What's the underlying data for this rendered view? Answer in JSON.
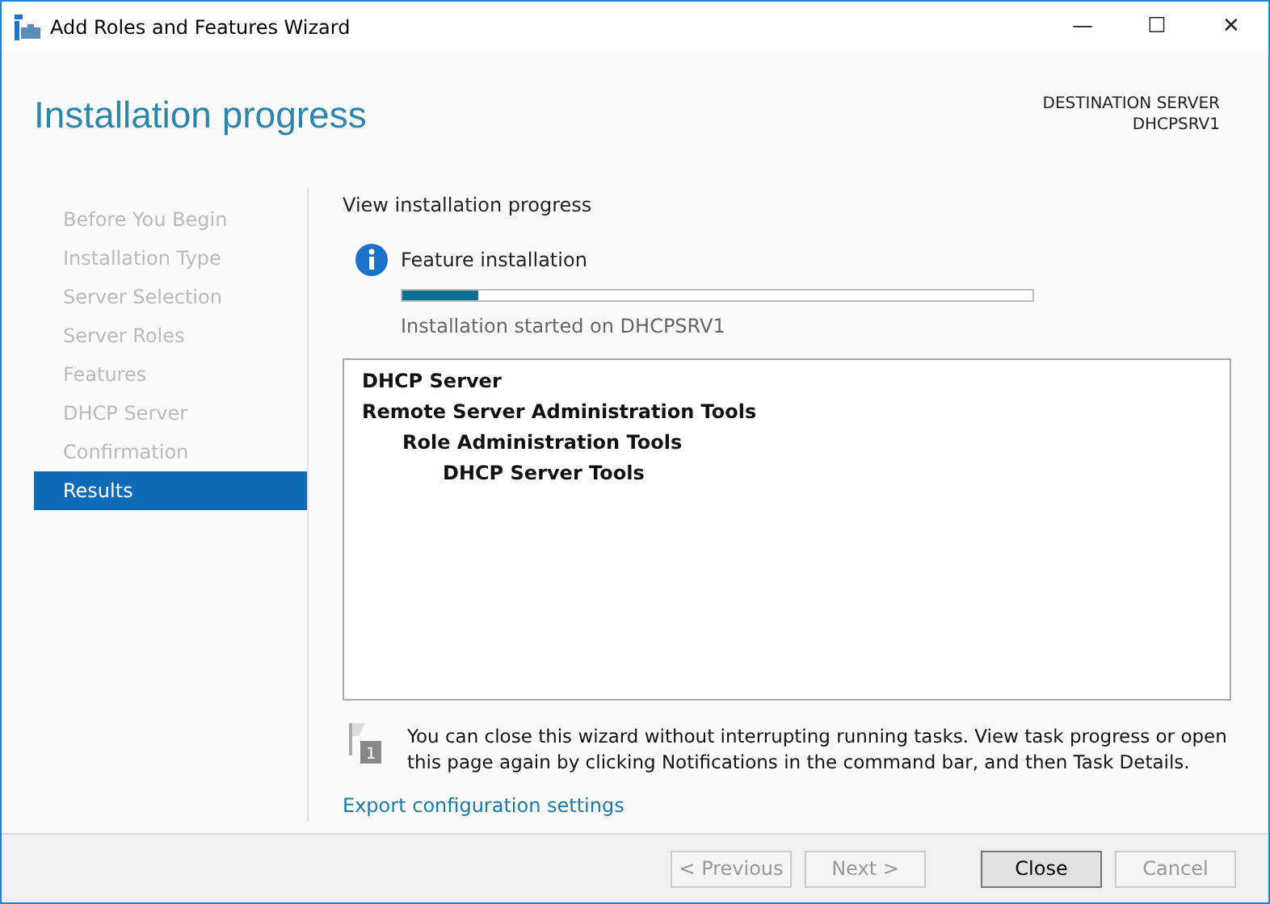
{
  "window": {
    "title": "Add Roles and Features Wizard",
    "controls": [
      "—",
      "☐",
      "✕"
    ]
  },
  "header": {
    "title": "Installation progress",
    "destination_label": "DESTINATION SERVER",
    "destination_server": "DHCPSRV1"
  },
  "sidebar": {
    "items": [
      {
        "label": "Before You Begin",
        "selected": false
      },
      {
        "label": "Installation Type",
        "selected": false
      },
      {
        "label": "Server Selection",
        "selected": false
      },
      {
        "label": "Server Roles",
        "selected": false
      },
      {
        "label": "Features",
        "selected": false
      },
      {
        "label": "DHCP Server",
        "selected": false
      },
      {
        "label": "Confirmation",
        "selected": false
      },
      {
        "label": "Results",
        "selected": true
      }
    ]
  },
  "content": {
    "heading": "View installation progress",
    "status": {
      "title": "Feature installation",
      "level": 0.12,
      "message": "Installation started on DHCPSRV1"
    },
    "results": [
      {
        "label": "DHCP Server"
      },
      {
        "label": "Remote Server Administration Tools",
        "children": [
          {
            "label": "Role Administration Tools",
            "children": [
              {
                "label": "DHCP Server Tools"
              }
            ]
          }
        ]
      }
    ],
    "note": {
      "badge": "1",
      "text": "You can close this wizard without interrupting running tasks. View task progress or open this page again by clicking Notifications in the command bar, and then Task Details."
    },
    "export_link": "Export configuration settings"
  },
  "buttons": [
    {
      "label": "< Previous",
      "disabled": true,
      "default": false
    },
    {
      "label": "Next >",
      "disabled": true,
      "default": false
    },
    {
      "label": "Close",
      "disabled": false,
      "default": true
    },
    {
      "label": "Cancel",
      "disabled": true,
      "default": false
    }
  ]
}
